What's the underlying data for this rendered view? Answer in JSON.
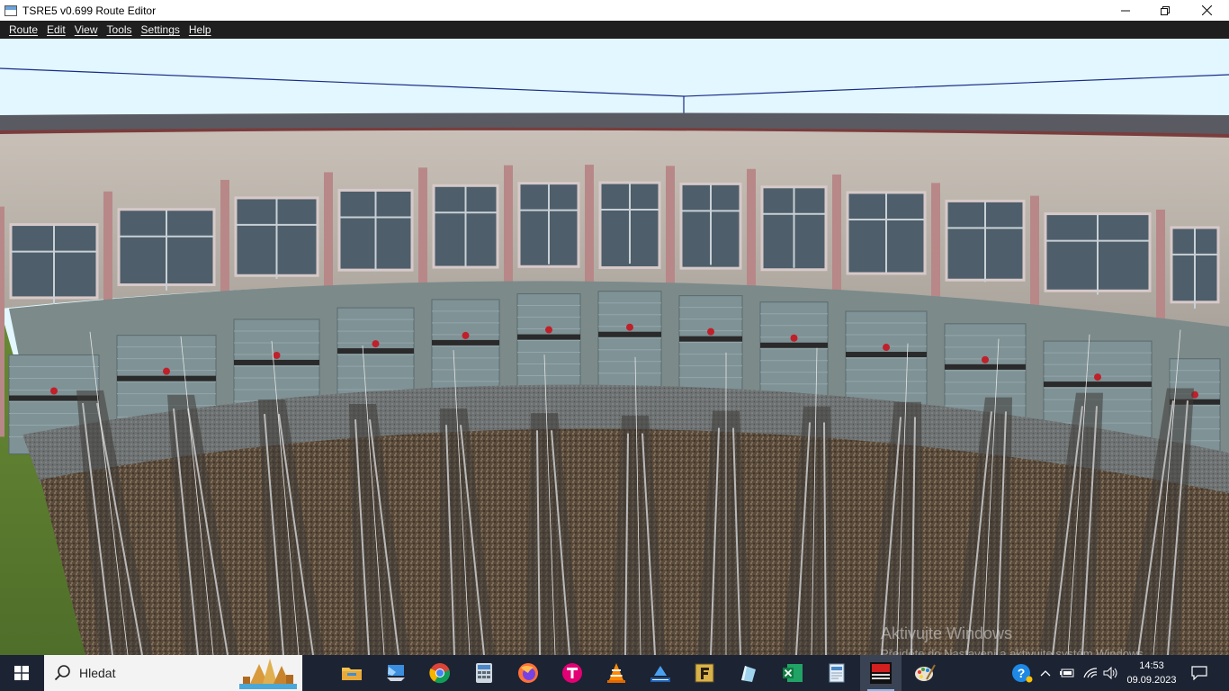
{
  "window": {
    "title": "TSRE5 v0.699 Route Editor",
    "controls": {
      "minimize": "—",
      "maximize": "❐",
      "close": "✕"
    }
  },
  "menu": [
    "Route",
    "Edit",
    "View",
    "Tools",
    "Settings",
    "Help"
  ],
  "viewport": {
    "content": "3d-roundhouse-scene",
    "watermark": {
      "title": "Aktivujte Windows",
      "subtitle": "Přejděte do Nastavení a aktivujte systém Windows."
    }
  },
  "taskbar": {
    "search_placeholder": "Hledat",
    "apps": [
      {
        "name": "file-explorer",
        "icon": "folder-icon"
      },
      {
        "name": "remote-desktop",
        "icon": "monitor-icon"
      },
      {
        "name": "chrome",
        "icon": "chrome-icon"
      },
      {
        "name": "calculator",
        "icon": "calculator-icon"
      },
      {
        "name": "firefox",
        "icon": "firefox-icon"
      },
      {
        "name": "app-t",
        "icon": "t-logo-icon"
      },
      {
        "name": "vlc",
        "icon": "vlc-icon"
      },
      {
        "name": "app-triangle",
        "icon": "triangle-icon"
      },
      {
        "name": "app-f",
        "icon": "f-logo-icon"
      },
      {
        "name": "app-pen",
        "icon": "pen-icon"
      },
      {
        "name": "excel",
        "icon": "excel-icon"
      },
      {
        "name": "notepad",
        "icon": "document-icon"
      },
      {
        "name": "route-editor",
        "icon": "route-editor-icon",
        "active": true
      },
      {
        "name": "paint",
        "icon": "palette-icon"
      }
    ],
    "tray": {
      "help": "?",
      "time": "14:53",
      "date": "09.09.2023"
    }
  }
}
